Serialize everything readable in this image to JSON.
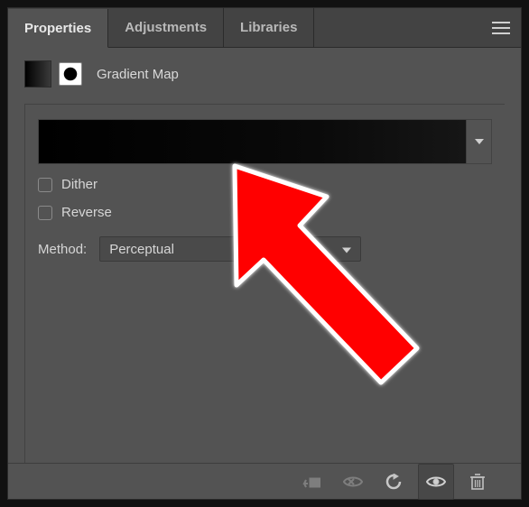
{
  "tabs": {
    "properties": "Properties",
    "adjustments": "Adjustments",
    "libraries": "Libraries"
  },
  "header": {
    "title": "Gradient Map"
  },
  "controls": {
    "dither_label": "Dither",
    "reverse_label": "Reverse",
    "method_label": "Method:",
    "method_value": "Perceptual"
  }
}
